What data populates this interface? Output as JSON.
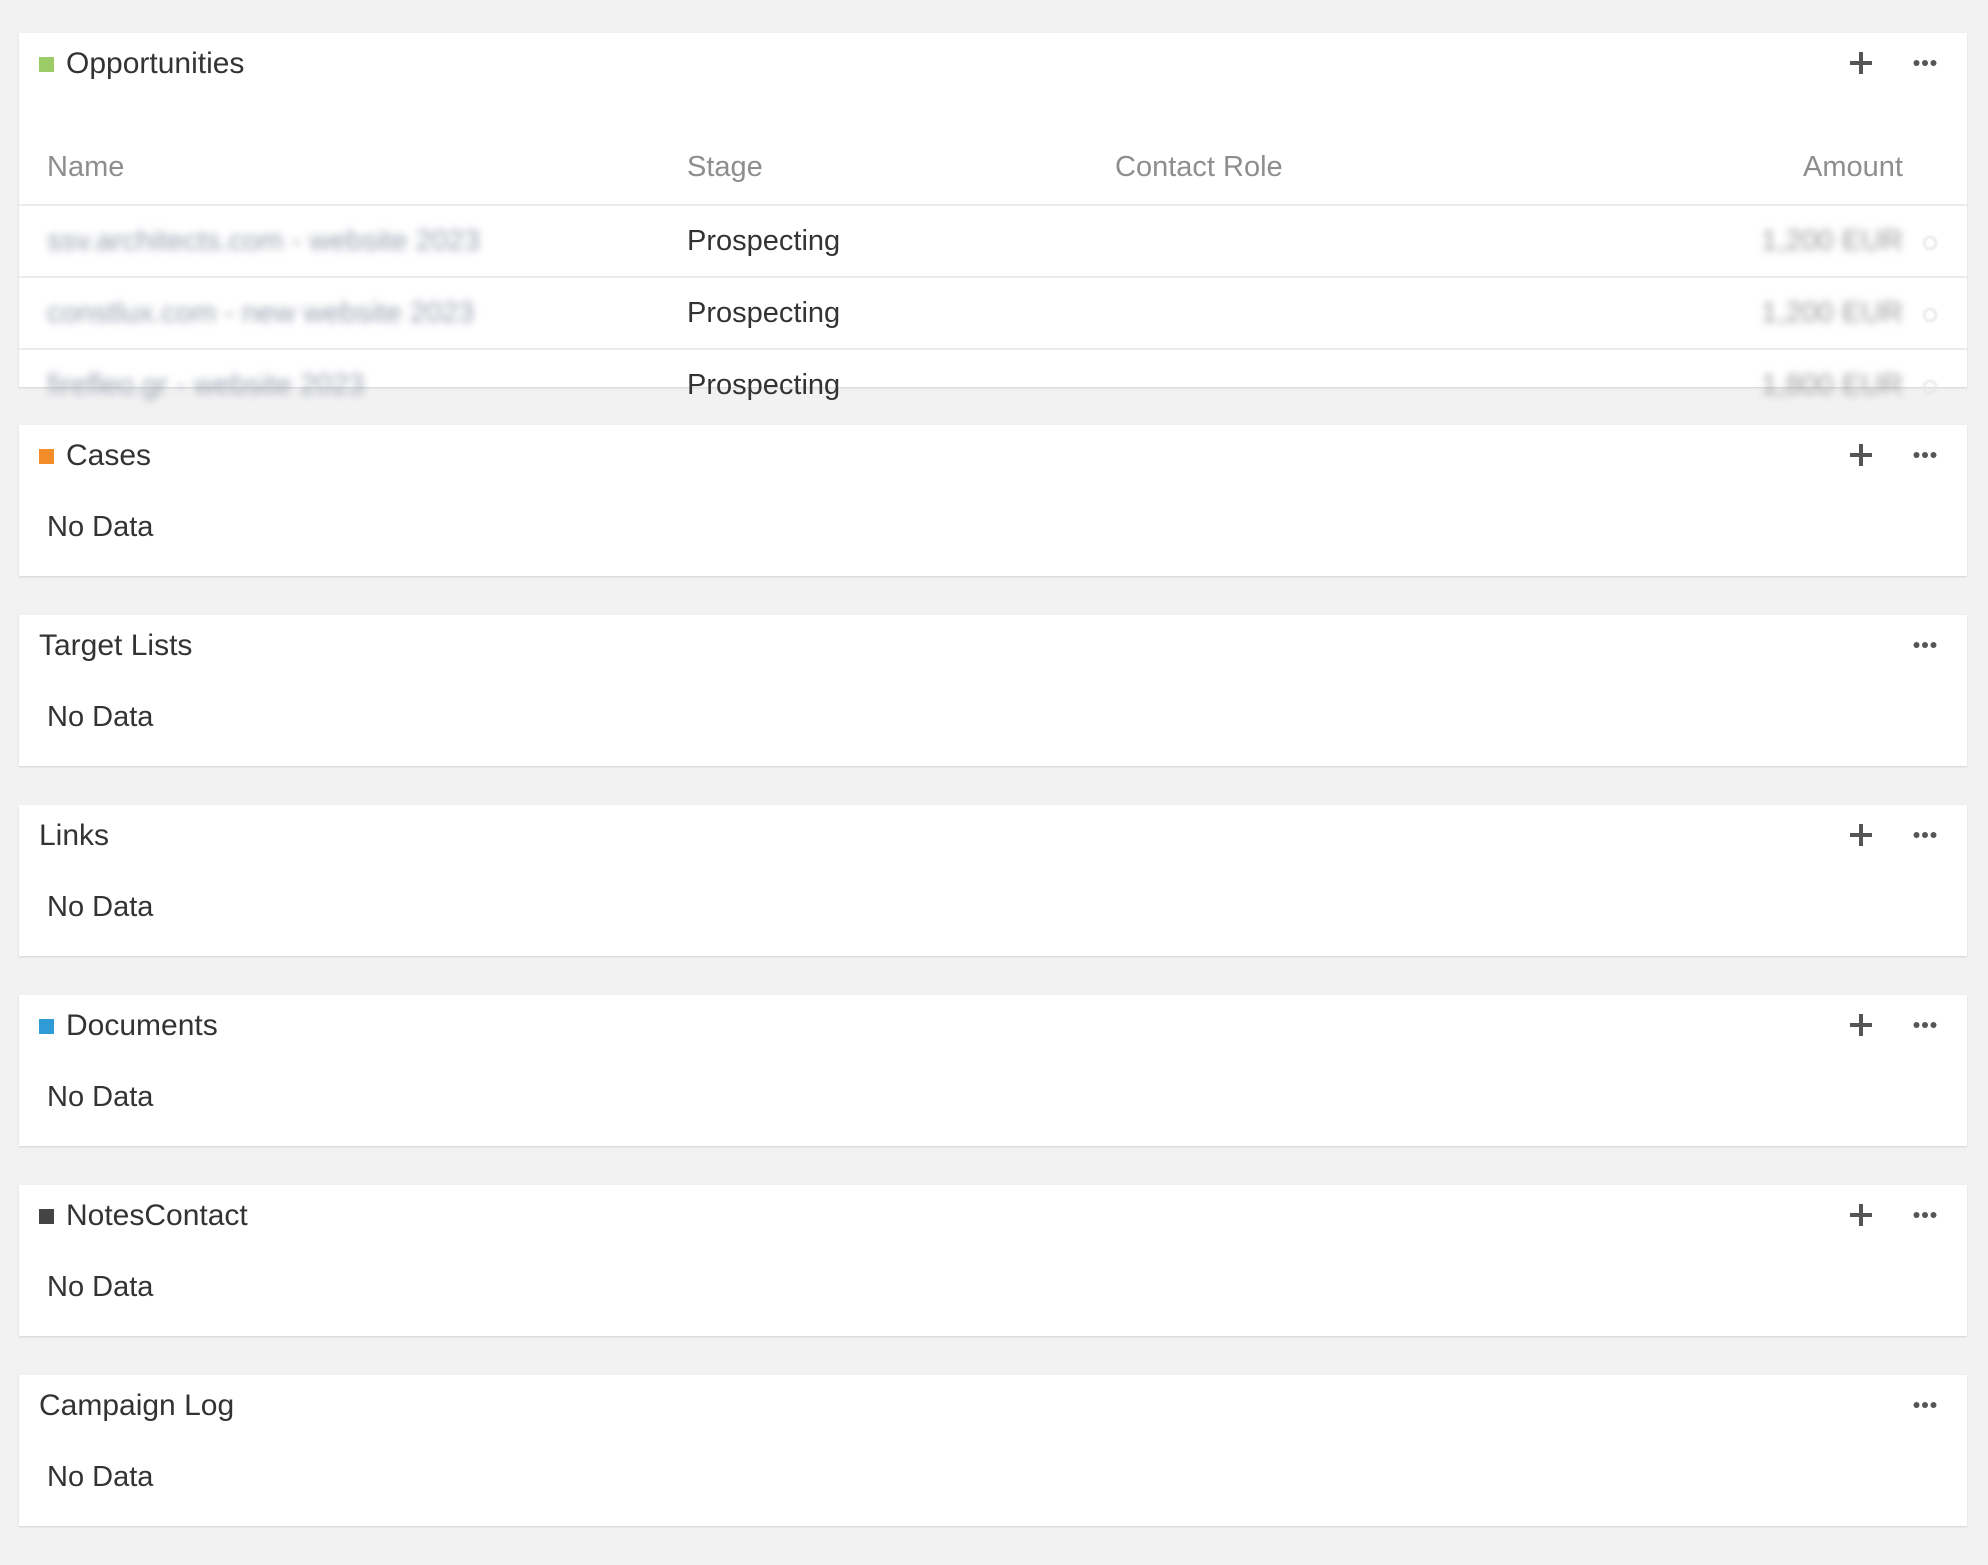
{
  "colors": {
    "opportunities": "#9ccc65",
    "cases": "#f28c28",
    "documents": "#2f9bd6",
    "notes_contact": "#444444",
    "page_background": "#f2f2f2"
  },
  "opportunities": {
    "title": "Opportunities",
    "columns": {
      "name": "Name",
      "stage": "Stage",
      "contact_role": "Contact Role",
      "amount": "Amount"
    },
    "rows": [
      {
        "name": "ssv.architects.com - website 2023",
        "stage": "Prospecting",
        "contact_role": "",
        "amount": "1,200 EUR"
      },
      {
        "name": "constlux.com - new website 2023",
        "stage": "Prospecting",
        "contact_role": "",
        "amount": "1,200 EUR"
      },
      {
        "name": "firefleo.gr - website 2023",
        "stage": "Prospecting",
        "contact_role": "",
        "amount": "1,800 EUR"
      }
    ]
  },
  "cases": {
    "title": "Cases",
    "empty_text": "No Data"
  },
  "target_lists": {
    "title": "Target Lists",
    "empty_text": "No Data"
  },
  "links": {
    "title": "Links",
    "empty_text": "No Data"
  },
  "documents": {
    "title": "Documents",
    "empty_text": "No Data"
  },
  "notes_contact": {
    "title": "NotesContact",
    "empty_text": "No Data"
  },
  "campaign_log": {
    "title": "Campaign Log",
    "empty_text": "No Data"
  },
  "icons": {
    "add": "plus-icon",
    "menu": "more-dots-icon"
  }
}
